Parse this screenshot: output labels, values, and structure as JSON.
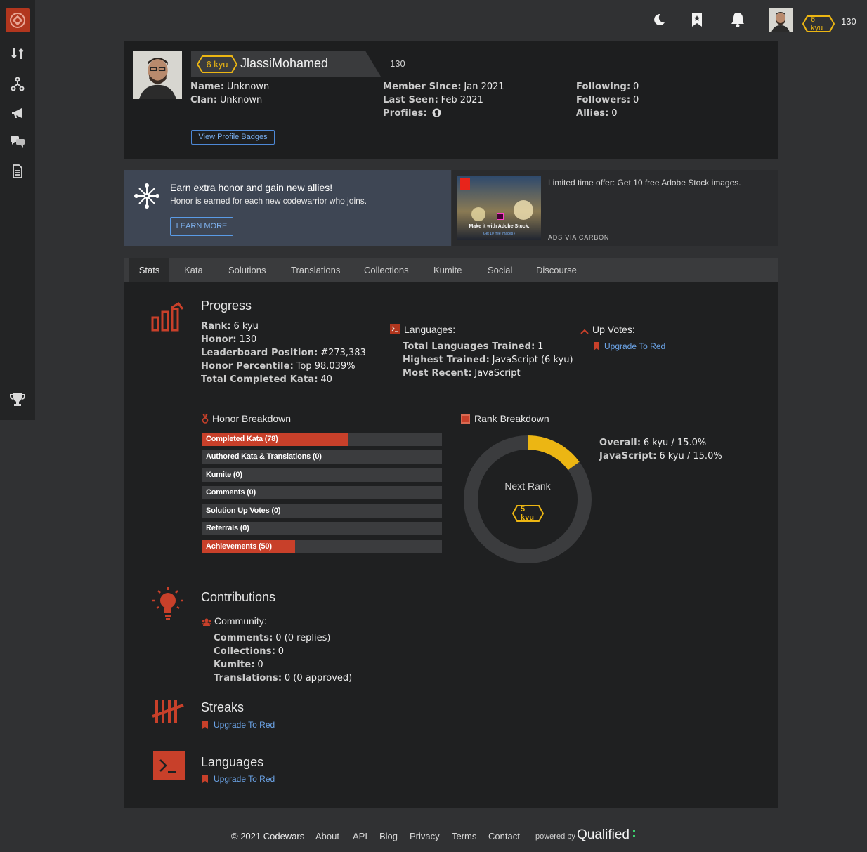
{
  "topbar": {
    "rank_badge": "6 kyu",
    "honor": "130"
  },
  "profile": {
    "rank_badge": "6 kyu",
    "username": "JlassiMohamed",
    "honor": "130",
    "name_label": "Name:",
    "name_value": "Unknown",
    "clan_label": "Clan:",
    "clan_value": "Unknown",
    "member_since_label": "Member Since:",
    "member_since_value": "Jan 2021",
    "last_seen_label": "Last Seen:",
    "last_seen_value": "Feb 2021",
    "profiles_label": "Profiles:",
    "following_label": "Following:",
    "following_value": "0",
    "followers_label": "Followers:",
    "followers_value": "0",
    "allies_label": "Allies:",
    "allies_value": "0",
    "badges_button": "View Profile Badges"
  },
  "honor_banner": {
    "title": "Earn extra honor and gain new allies!",
    "subtitle": "Honor is earned for each new codewarrior who joins.",
    "button": "LEARN MORE"
  },
  "ad": {
    "image_text": "Make it with Adobe Stock.",
    "image_subtext": "Get 10 free images ›",
    "text": "Limited time offer: Get 10 free Adobe Stock images.",
    "via": "ADS VIA CARBON"
  },
  "tabs": [
    "Stats",
    "Kata",
    "Solutions",
    "Translations",
    "Collections",
    "Kumite",
    "Social",
    "Discourse"
  ],
  "progress": {
    "title": "Progress",
    "rank_label": "Rank:",
    "rank_value": "6 kyu",
    "honor_label": "Honor:",
    "honor_value": "130",
    "leaderboard_label": "Leaderboard Position:",
    "leaderboard_value": "#273,383",
    "percentile_label": "Honor Percentile:",
    "percentile_value": "Top 98.039%",
    "completed_label": "Total Completed Kata:",
    "completed_value": "40"
  },
  "languages_stats": {
    "title": "Languages:",
    "trained_label": "Total Languages Trained:",
    "trained_value": "1",
    "highest_label": "Highest Trained:",
    "highest_value": "JavaScript (6 kyu)",
    "recent_label": "Most Recent:",
    "recent_value": "JavaScript"
  },
  "upvotes": {
    "title": "Up Votes:",
    "link": "Upgrade To Red"
  },
  "honor_breakdown": {
    "title": "Honor Breakdown",
    "bars": [
      {
        "label": "Completed Kata (78)",
        "fill": 0.61
      },
      {
        "label": "Authored Kata & Translations (0)",
        "fill": 0
      },
      {
        "label": "Kumite (0)",
        "fill": 0
      },
      {
        "label": "Comments (0)",
        "fill": 0
      },
      {
        "label": "Solution Up Votes (0)",
        "fill": 0
      },
      {
        "label": "Referrals (0)",
        "fill": 0
      },
      {
        "label": "Achievements (50)",
        "fill": 0.39
      }
    ]
  },
  "rank_breakdown": {
    "title": "Rank Breakdown",
    "progress": 0.15,
    "next_rank_label": "Next Rank",
    "next_rank_badge": "5 kyu",
    "overall_label": "Overall:",
    "overall_value": "6 kyu / 15.0%",
    "js_label": "JavaScript:",
    "js_value": "6 kyu / 15.0%"
  },
  "contributions": {
    "title": "Contributions",
    "community_label": "Community:",
    "comments_label": "Comments:",
    "comments_value": "0 (0 replies)",
    "collections_label": "Collections:",
    "collections_value": "0",
    "kumite_label": "Kumite:",
    "kumite_value": "0",
    "translations_label": "Translations:",
    "translations_value": "0 (0 approved)"
  },
  "streaks": {
    "title": "Streaks",
    "link": "Upgrade To Red"
  },
  "languages": {
    "title": "Languages",
    "link": "Upgrade To Red"
  },
  "footer": {
    "copyright": "© 2021 Codewars",
    "links": [
      "About",
      "API",
      "Blog",
      "Privacy",
      "Terms",
      "Contact"
    ],
    "powered_by": "powered by",
    "brand": "Qualified"
  },
  "colors": {
    "accent": "#b1361e",
    "rank_yellow": "#ecb613",
    "link_blue": "#6ba3e6"
  }
}
